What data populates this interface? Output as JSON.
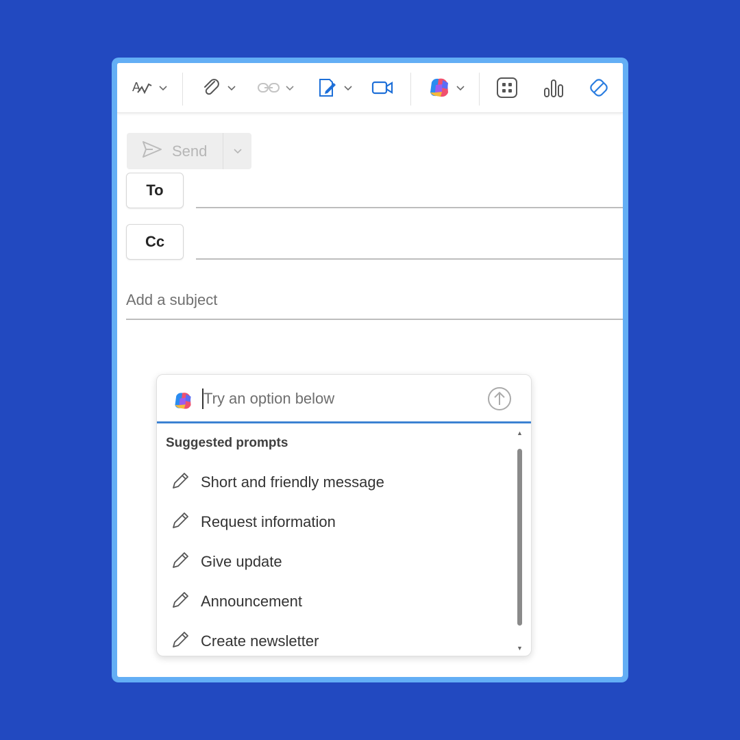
{
  "compose": {
    "send_label": "Send",
    "to_label": "To",
    "cc_label": "Cc",
    "subject_placeholder": "Add a subject"
  },
  "toolbar": {
    "icons": [
      "editor-icon",
      "attach-icon",
      "link-icon",
      "signature-icon",
      "meeting-icon",
      "copilot-icon",
      "apps-icon",
      "insights-icon",
      "loop-icon"
    ]
  },
  "copilot": {
    "input_placeholder": "Try an option below",
    "section_title": "Suggested prompts",
    "prompts": [
      {
        "label": "Short and friendly message"
      },
      {
        "label": "Request information"
      },
      {
        "label": "Give update"
      },
      {
        "label": "Announcement"
      },
      {
        "label": "Create newsletter"
      }
    ]
  },
  "colors": {
    "background": "#2249c0",
    "frame": "#63aef5",
    "accent": "#3c82d2"
  }
}
